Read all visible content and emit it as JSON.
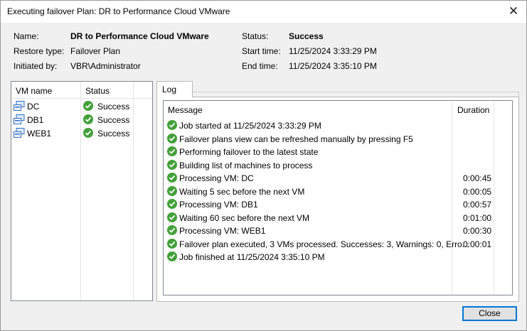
{
  "window": {
    "title": "Executing failover Plan: DR to Performance Cloud VMware",
    "close_glyph": "✕"
  },
  "info": {
    "name_label": "Name:",
    "name_value": "DR to Performance Cloud VMware",
    "restore_type_label": "Restore type:",
    "restore_type_value": "Failover Plan",
    "initiated_by_label": "Initiated by:",
    "initiated_by_value": "VBR\\Administrator",
    "status_label": "Status:",
    "status_value": "Success",
    "start_time_label": "Start time:",
    "start_time_value": "11/25/2024 3:33:29 PM",
    "end_time_label": "End time:",
    "end_time_value": "11/25/2024 3:35:10 PM"
  },
  "vm_table": {
    "headers": {
      "name": "VM name",
      "status": "Status"
    },
    "rows": [
      {
        "name": "DC",
        "status": "Success"
      },
      {
        "name": "DB1",
        "status": "Success"
      },
      {
        "name": "WEB1",
        "status": "Success"
      }
    ]
  },
  "tabs": {
    "log": "Log"
  },
  "log": {
    "headers": {
      "message": "Message",
      "duration": "Duration"
    },
    "rows": [
      {
        "message": "Job started at 11/25/2024 3:33:29 PM",
        "duration": ""
      },
      {
        "message": "Failover plans view can be refreshed manually by pressing F5",
        "duration": ""
      },
      {
        "message": "Performing failover to the latest state",
        "duration": ""
      },
      {
        "message": "Building list of machines to process",
        "duration": ""
      },
      {
        "message": "Processing VM: DC",
        "duration": "0:00:45"
      },
      {
        "message": "Waiting 5 sec before the next VM",
        "duration": "0:00:05"
      },
      {
        "message": "Processing VM: DB1",
        "duration": "0:00:57"
      },
      {
        "message": "Waiting 60 sec before the next VM",
        "duration": "0:01:00"
      },
      {
        "message": "Processing VM: WEB1",
        "duration": "0:00:30"
      },
      {
        "message": "Failover plan executed, 3 VMs processed. Successes: 3, Warnings: 0, Erro...",
        "duration": "0:00:01"
      },
      {
        "message": "Job finished at 11/25/2024 3:35:10 PM",
        "duration": ""
      }
    ]
  },
  "buttons": {
    "close": "Close"
  },
  "colors": {
    "success_green": "#44a13a",
    "focus_blue": "#0078d7",
    "vm_icon_blue": "#2f6fc3"
  },
  "icons": {
    "status": "check-circle-icon",
    "vm": "vm-icon",
    "close": "close-icon"
  }
}
